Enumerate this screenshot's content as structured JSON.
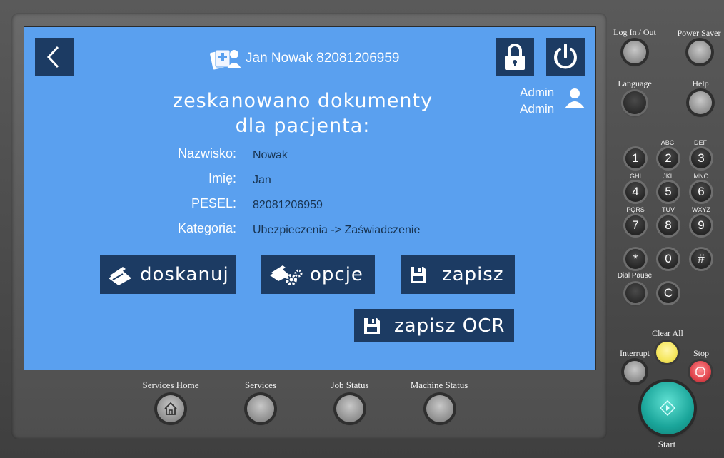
{
  "patient": {
    "header_text": "Jan Nowak 82081206959"
  },
  "user": {
    "first": "Admin",
    "second": "Admin"
  },
  "heading": {
    "line1": "zeskanowano dokumenty",
    "line2": "dla pacjenta:"
  },
  "fields": [
    {
      "label": "Nazwisko:",
      "value": "Nowak"
    },
    {
      "label": "Imię:",
      "value": "Jan"
    },
    {
      "label": "PESEL:",
      "value": "82081206959"
    },
    {
      "label": "Kategoria:",
      "value": "Ubezpieczenia -> Zaświadczenie"
    }
  ],
  "actions": {
    "doskanuj": "doskanuj",
    "opcje": "opcje",
    "zapisz": "zapisz",
    "zapisz_ocr": "zapisz OCR"
  },
  "bottom_buttons": {
    "services_home": "Services Home",
    "services": "Services",
    "job_status": "Job Status",
    "machine_status": "Machine Status"
  },
  "side_buttons": {
    "log_in_out": "Log In / Out",
    "power_saver": "Power Saver",
    "language": "Language",
    "help": "Help",
    "dial_pause": "Dial Pause",
    "clear_all": "Clear All",
    "interrupt": "Interrupt",
    "stop": "Stop",
    "start": "Start"
  },
  "keypad": [
    {
      "key": "1",
      "sub": ""
    },
    {
      "key": "2",
      "sub": "ABC"
    },
    {
      "key": "3",
      "sub": "DEF"
    },
    {
      "key": "4",
      "sub": "GHI"
    },
    {
      "key": "5",
      "sub": "JKL"
    },
    {
      "key": "6",
      "sub": "MNO"
    },
    {
      "key": "7",
      "sub": "PQRS"
    },
    {
      "key": "8",
      "sub": "TUV"
    },
    {
      "key": "9",
      "sub": "WXYZ"
    },
    {
      "key": "*",
      "sub": ""
    },
    {
      "key": "0",
      "sub": ""
    },
    {
      "key": "#",
      "sub": ""
    },
    {
      "key": "C",
      "sub": ""
    }
  ],
  "colors": {
    "screen_bg": "#5aa0ef",
    "button_dark": "#1c3b63",
    "clear_all": "#f5e65c",
    "stop": "#e0444c",
    "start": "#1aa59a"
  }
}
